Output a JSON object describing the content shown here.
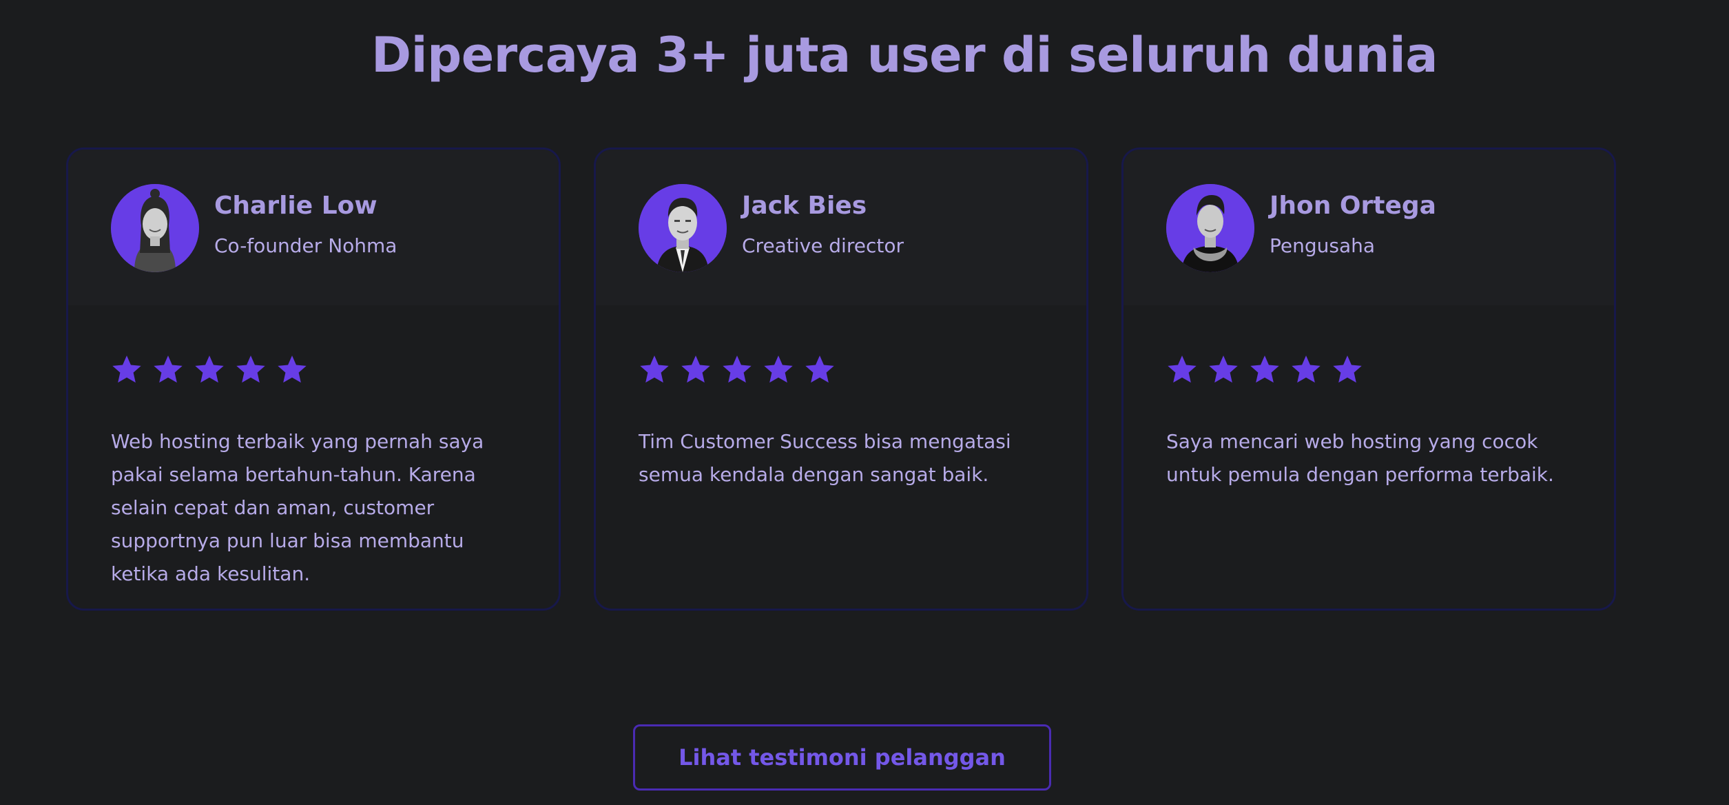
{
  "section": {
    "title": "Dipercaya 3+ juta user di seluruh dunia"
  },
  "colors": {
    "background": "#1b1c1e",
    "accent": "#673de6",
    "title": "#a89ae0",
    "card_border": "#17184a",
    "star": "#673de6"
  },
  "testimonials": [
    {
      "name": "Charlie Low",
      "role": "Co-founder Nohma",
      "rating": 5,
      "rating_max": 5,
      "avatar_icon": "person-photo-woman",
      "quote": "Web hosting terbaik yang pernah saya pakai selama bertahun-tahun. Karena selain cepat dan aman, customer supportnya pun luar bisa membantu ketika ada kesulitan."
    },
    {
      "name": "Jack Bies",
      "role": "Creative director",
      "rating": 5,
      "rating_max": 5,
      "avatar_icon": "person-photo-man-suit",
      "quote": "Tim Customer Success bisa mengatasi semua kendala dengan sangat baik."
    },
    {
      "name": "Jhon Ortega",
      "role": "Pengusaha",
      "rating": 5,
      "rating_max": 5,
      "avatar_icon": "person-photo-man-scarf",
      "quote": "Saya mencari web hosting yang cocok untuk pemula dengan performa terbaik."
    }
  ],
  "cta": {
    "label": "Lihat testimoni pelanggan"
  }
}
